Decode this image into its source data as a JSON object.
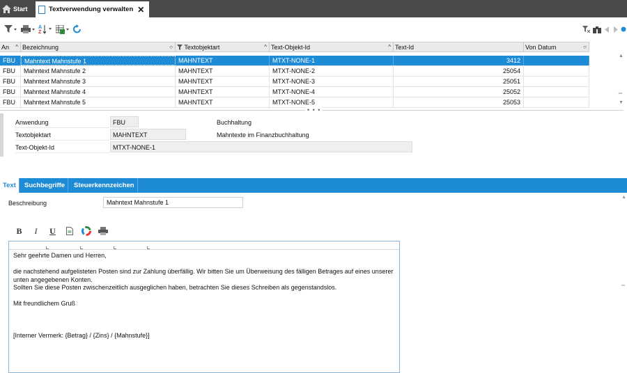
{
  "top_tabs": {
    "start_label": "Start",
    "active_label": "Textverwendung verwalten",
    "close_glyph": "✕"
  },
  "toolbar": {
    "icons": [
      "filter-icon",
      "print-icon",
      "sort-az-icon",
      "export-icon",
      "refresh-icon",
      "clear-filter-icon",
      "binoculars-icon",
      "nav-prev-icon",
      "nav-next-icon",
      "status-dot-icon"
    ]
  },
  "grid": {
    "columns": [
      {
        "key": "an",
        "label": "An"
      },
      {
        "key": "bez",
        "label": "Bezeichnung"
      },
      {
        "key": "art",
        "label": "Textobjektart"
      },
      {
        "key": "oid",
        "label": "Text-Objekt-Id"
      },
      {
        "key": "tid",
        "label": "Text-Id"
      },
      {
        "key": "von",
        "label": "Von Datum"
      }
    ],
    "rows": [
      {
        "an": "FBU",
        "bez": "Mahntext Mahnstufe 1",
        "art": "MAHNTEXT",
        "oid": "MTXT-NONE-1",
        "tid": "3412",
        "von": "",
        "selected": true
      },
      {
        "an": "FBU",
        "bez": "Mahntext Mahnstufe 2",
        "art": "MAHNTEXT",
        "oid": "MTXT-NONE-2",
        "tid": "25054",
        "von": ""
      },
      {
        "an": "FBU",
        "bez": "Mahntext Mahnstufe 3",
        "art": "MAHNTEXT",
        "oid": "MTXT-NONE-3",
        "tid": "25051",
        "von": ""
      },
      {
        "an": "FBU",
        "bez": "Mahntext Mahnstufe 4",
        "art": "MAHNTEXT",
        "oid": "MTXT-NONE-4",
        "tid": "25052",
        "von": ""
      },
      {
        "an": "FBU",
        "bez": "Mahntext Mahnstufe 5",
        "art": "MAHNTEXT",
        "oid": "MTXT-NONE-5",
        "tid": "25053",
        "von": ""
      }
    ]
  },
  "detail": {
    "anwendung_label": "Anwendung",
    "anwendung_value": "FBU",
    "anwendung_desc": "Buchhaltung",
    "textobjektart_label": "Textobjektart",
    "textobjektart_value": "MAHNTEXT",
    "textobjektart_desc": "Mahntexte im Finanzbuchhaltung",
    "textobjektid_label": "Text-Objekt-Id",
    "textobjektid_value": "MTXT-NONE-1"
  },
  "bottom_tabs": [
    {
      "label": "Text",
      "active": true
    },
    {
      "label": "Suchbegriffe"
    },
    {
      "label": "Steuerkennzeichen"
    }
  ],
  "text_tab": {
    "beschreibung_label": "Beschreibung",
    "beschreibung_value": "Mahntext Mahnstufe 1",
    "format_buttons": {
      "bold": "B",
      "italic": "I",
      "underline": "U"
    },
    "editor_lines": [
      "Sehr geehrte Damen und Herren,",
      "",
      "die nachstehend aufgelisteten Posten sind zur Zahlung überfällig. Wir bitten Sie um Überweisung des fälligen Betrages auf eines unserer unten angegebenen Konten.",
      "Sollten Sie diese Posten zwischenzeitlich ausgeglichen haben, betrachten Sie dieses Schreiben als gegenstandslos.",
      "",
      "Mit freundlichem Gruß",
      "",
      "",
      "",
      "[Interner Vermerk: {Betrag} / {Zins} / {Mahnstufe}]"
    ]
  },
  "colors": {
    "accent": "#1e8bd6",
    "topbar": "#4a4a4a"
  }
}
